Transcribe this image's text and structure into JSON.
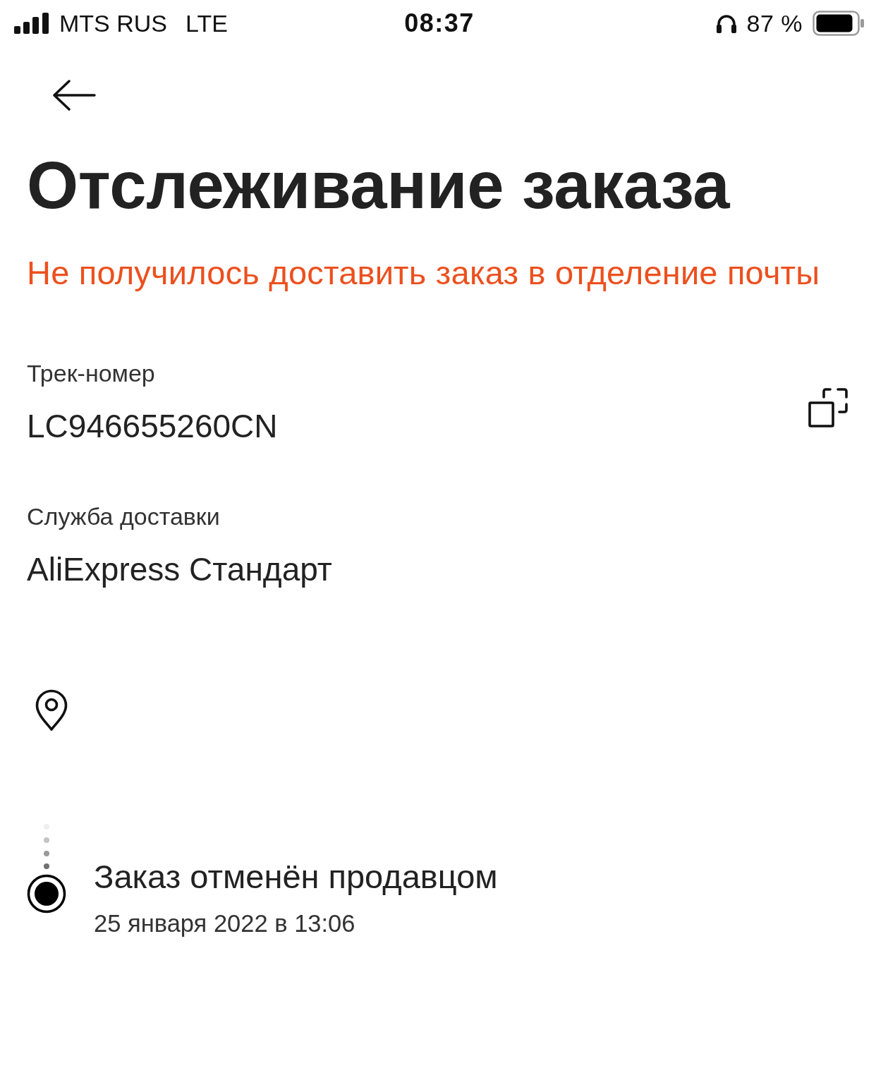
{
  "status_bar": {
    "carrier": "MTS RUS",
    "network": "LTE",
    "time": "08:37",
    "battery": "87 %"
  },
  "header": {
    "title": "Отслеживание заказа"
  },
  "status_message": "Не получилось доставить заказ в отделение почты",
  "fields": [
    {
      "label": "Трек-номер",
      "value": "LC946655260CN",
      "copyable": true
    },
    {
      "label": "Служба доставки",
      "value": "AliExpress Стандарт",
      "copyable": false
    }
  ],
  "timeline": [
    {
      "title": "Заказ отменён продавцом",
      "date": "25 января 2022 в 13:06",
      "current": true
    }
  ]
}
